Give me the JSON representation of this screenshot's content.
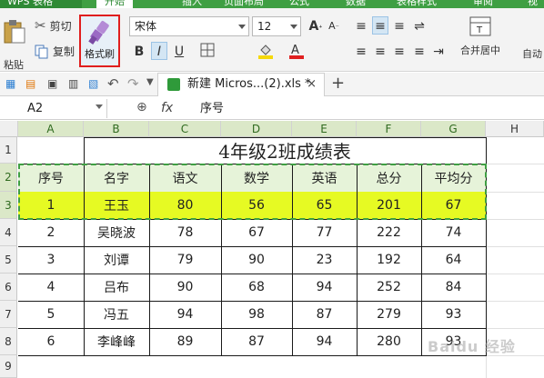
{
  "app": {
    "name": "WPS 表格"
  },
  "menu_tabs": [
    "开始",
    "插入",
    "页面布局",
    "公式",
    "数据",
    "表格样式",
    "审阅",
    "视"
  ],
  "ribbon": {
    "cut": "剪切",
    "copy": "复制",
    "paste": "粘贴",
    "format_painter": "格式刷",
    "font_name": "宋体",
    "font_size": "12",
    "bold": "B",
    "italic": "I",
    "underline": "U",
    "merge_center": "合并居中",
    "auto_wrap": "自动"
  },
  "doc_tab": {
    "title": "新建 Micros...(2).xls *",
    "close": "×",
    "add": "+"
  },
  "formula_bar": {
    "name_box": "A2",
    "fx": "fx",
    "content": "序号"
  },
  "columns": [
    "A",
    "B",
    "C",
    "D",
    "E",
    "F",
    "G",
    "H"
  ],
  "rows": [
    "1",
    "2",
    "3",
    "4",
    "5",
    "6",
    "7",
    "8",
    "9"
  ],
  "sheet": {
    "title": "4年级2班成绩表",
    "headers": [
      "序号",
      "名字",
      "语文",
      "数学",
      "英语",
      "总分",
      "平均分"
    ],
    "data": [
      [
        "1",
        "王玉",
        "80",
        "56",
        "65",
        "201",
        "67"
      ],
      [
        "2",
        "吴晓波",
        "78",
        "67",
        "77",
        "222",
        "74"
      ],
      [
        "3",
        "刘谭",
        "79",
        "90",
        "23",
        "192",
        "64"
      ],
      [
        "4",
        "吕布",
        "90",
        "68",
        "94",
        "252",
        "84"
      ],
      [
        "5",
        "冯五",
        "94",
        "98",
        "87",
        "279",
        "93"
      ],
      [
        "6",
        "李峰峰",
        "89",
        "87",
        "94",
        "280",
        "93"
      ]
    ]
  },
  "colors": {
    "header_fill": "#e6f3d9",
    "highlight_fill": "#e6fa23",
    "accent": "#3f9f43"
  },
  "watermark": "Baidu 经验"
}
